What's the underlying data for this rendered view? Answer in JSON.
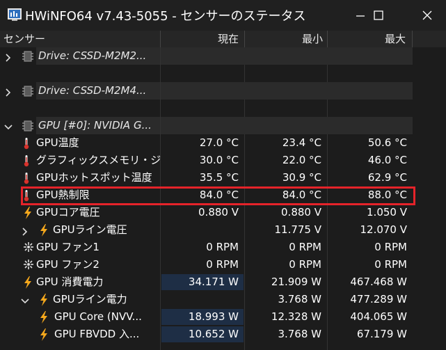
{
  "window": {
    "title": "HWiNFO64 v7.43-5055 - センサーのステータス"
  },
  "columns": {
    "sensor": "センサー",
    "current": "現在",
    "min": "最小",
    "max": "最大"
  },
  "colors": {
    "highlight": "#e5232a",
    "value_bar": "#1e2e45",
    "thermometer": "#d8322c",
    "bolt": "#f5a81c"
  },
  "rows": [
    {
      "type": "group",
      "expanded": false,
      "icon": "chip-icon",
      "name": "Drive: CSSD-M2M2..."
    },
    {
      "type": "group",
      "expanded": false,
      "icon": "chip-icon",
      "name": "Drive: CSSD-M2M4..."
    },
    {
      "type": "group",
      "expanded": true,
      "icon": "chip-icon",
      "name": "GPU [#0]: NVIDIA G..."
    },
    {
      "type": "sensor",
      "icon": "thermometer-icon",
      "name": "GPU温度",
      "current": "27.0 °C",
      "min": "23.4 °C",
      "max": "50.6 °C"
    },
    {
      "type": "sensor",
      "icon": "thermometer-icon",
      "name": "グラフィックスメモリ・ジ...",
      "current": "30.0 °C",
      "min": "22.0 °C",
      "max": "46.0 °C"
    },
    {
      "type": "sensor",
      "icon": "thermometer-icon",
      "name": "GPUホットスポット温度",
      "current": "35.5 °C",
      "min": "30.9 °C",
      "max": "62.9 °C"
    },
    {
      "type": "sensor",
      "icon": "thermometer-icon",
      "name": "GPU熱制限",
      "current": "84.0 °C",
      "min": "84.0 °C",
      "max": "88.0 °C",
      "highlighted": true
    },
    {
      "type": "sensor",
      "icon": "lightning-icon",
      "name": "GPUコア電圧",
      "current": "0.880 V",
      "min": "0.880 V",
      "max": "1.050 V"
    },
    {
      "type": "sensor",
      "icon": "lightning-icon",
      "name": "GPUライン電圧",
      "current": "",
      "min": "11.775 V",
      "max": "12.070 V",
      "expandable": true
    },
    {
      "type": "sensor",
      "icon": "fan-icon",
      "name": "GPU ファン1",
      "current": "0 RPM",
      "min": "0 RPM",
      "max": "0 RPM"
    },
    {
      "type": "sensor",
      "icon": "fan-icon",
      "name": "GPU ファン2",
      "current": "0 RPM",
      "min": "0 RPM",
      "max": "0 RPM"
    },
    {
      "type": "sensor",
      "icon": "lightning-icon",
      "name": "GPU 消費電力",
      "current": "34.171 W",
      "min": "21.909 W",
      "max": "467.468 W",
      "bar": true
    },
    {
      "type": "sensor",
      "icon": "lightning-icon",
      "name": "GPUライン電力",
      "current": "",
      "min": "3.768 W",
      "max": "477.289 W",
      "expanded": true
    },
    {
      "type": "sensor",
      "icon": "lightning-icon",
      "name": "GPU Core (NVV...",
      "current": "18.993 W",
      "min": "12.328 W",
      "max": "404.065 W",
      "bar": true
    },
    {
      "type": "sensor",
      "icon": "lightning-icon",
      "name": "GPU FBVDD 入...",
      "current": "10.652 W",
      "min": "3.768 W",
      "max": "67.179 W",
      "bar": true
    }
  ]
}
